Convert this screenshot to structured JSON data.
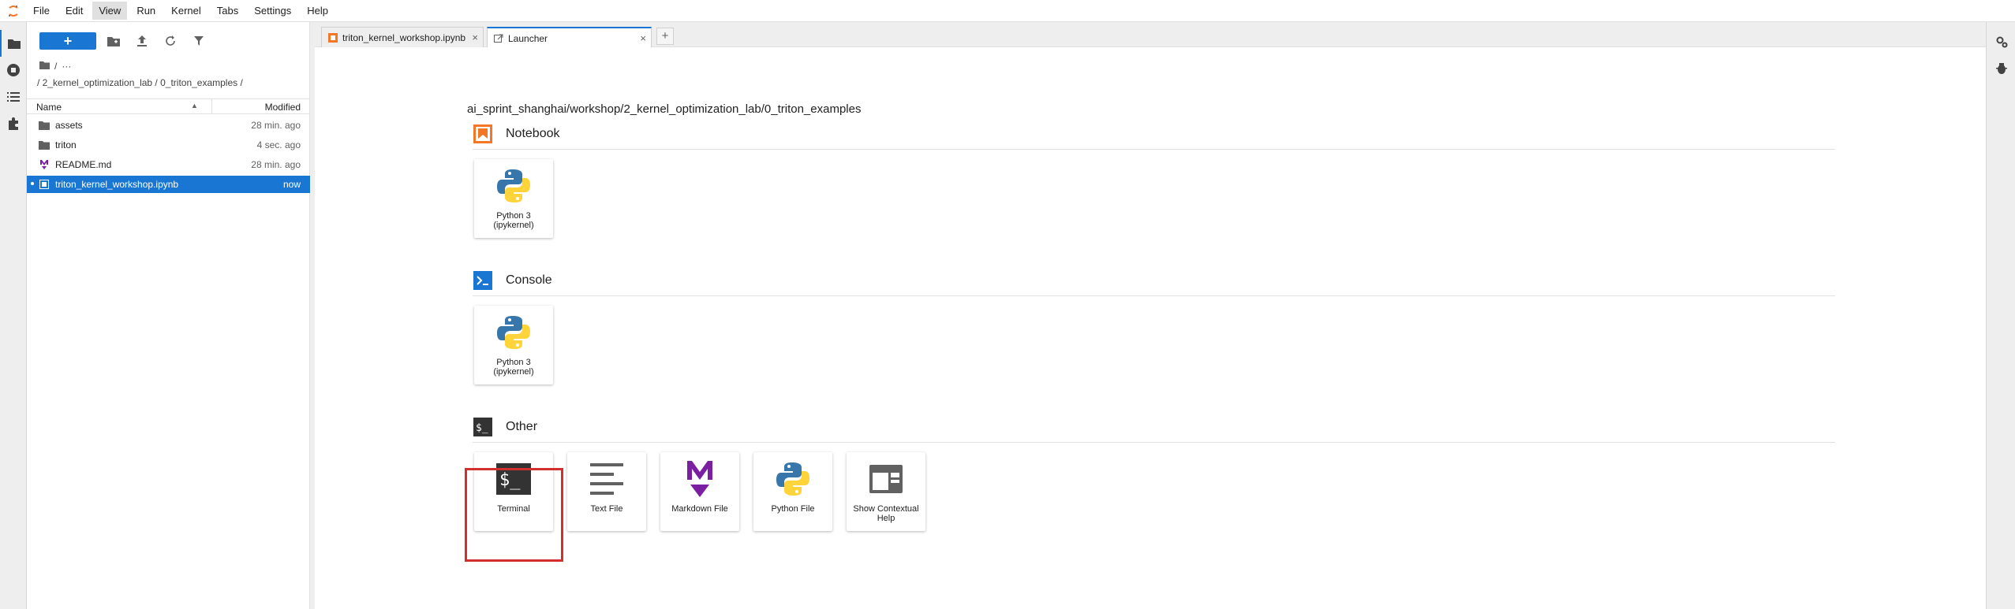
{
  "menubar": {
    "items": [
      "File",
      "Edit",
      "View",
      "Run",
      "Kernel",
      "Tabs",
      "Settings",
      "Help"
    ],
    "active": "View"
  },
  "leftbar": {
    "icons": [
      "folder-icon",
      "running-icon",
      "toc-icon",
      "extension-icon"
    ]
  },
  "filebrowser": {
    "new_label": "+",
    "crumb_root": "/",
    "crumb_more": "···",
    "crumb_path": "/ 2_kernel_optimization_lab / 0_triton_examples /",
    "col_name": "Name",
    "col_modified": "Modified",
    "files": [
      {
        "name": "assets",
        "modified": "28 min. ago",
        "type": "folder"
      },
      {
        "name": "triton",
        "modified": "4 sec. ago",
        "type": "folder"
      },
      {
        "name": "README.md",
        "modified": "28 min. ago",
        "type": "markdown"
      },
      {
        "name": "triton_kernel_workshop.ipynb",
        "modified": "now",
        "type": "notebook",
        "selected": true
      }
    ]
  },
  "tabs": [
    {
      "label": "triton_kernel_workshop.ipynb",
      "icon": "notebook-icon",
      "close": "×",
      "current": false
    },
    {
      "label": "Launcher",
      "icon": "launcher-icon",
      "close": "×",
      "current": true
    }
  ],
  "add_tab_label": "+",
  "launcher": {
    "path": "ai_sprint_shanghai/workshop/2_kernel_optimization_lab/0_triton_examples",
    "sections": [
      {
        "title": "Notebook",
        "cards": [
          {
            "label": "Python 3 (ipykernel)"
          }
        ]
      },
      {
        "title": "Console",
        "cards": [
          {
            "label": "Python 3 (ipykernel)"
          }
        ]
      },
      {
        "title": "Other",
        "cards": [
          {
            "label": "Terminal"
          },
          {
            "label": "Text File"
          },
          {
            "label": "Markdown File"
          },
          {
            "label": "Python File"
          },
          {
            "label": "Show Contextual Help"
          }
        ]
      }
    ],
    "highlighted_card": "Terminal"
  },
  "colors": {
    "accent": "#1976d2",
    "notebook_orange": "#f37726",
    "console_blue": "#0d47a1",
    "terminal_dark": "#333333",
    "markdown_purple": "#7b1fa2",
    "highlight_red": "#d32f2f"
  }
}
